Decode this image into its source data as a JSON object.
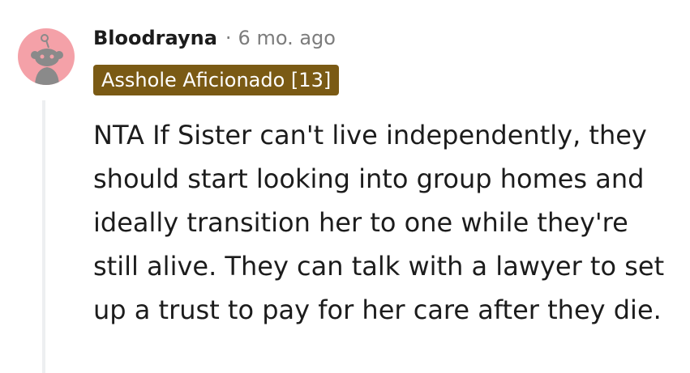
{
  "comment": {
    "author": "Bloodrayna",
    "separator": "·",
    "timestamp": "6 mo. ago",
    "flair": "Asshole Aficionado [13]",
    "body": "NTA If Sister can't live independently, they should start looking into group homes and ideally transition her to one while they're still alive. They can talk with a lawyer to set up a trust to pay for her care after they die."
  },
  "avatar": {
    "icon": "snoo-avatar-icon",
    "background_color": "#f4a1a8"
  },
  "colors": {
    "flair_background": "#7a5a14",
    "text": "#1c1c1c",
    "muted": "#7c7c7c",
    "thread_line": "#edeff1"
  }
}
